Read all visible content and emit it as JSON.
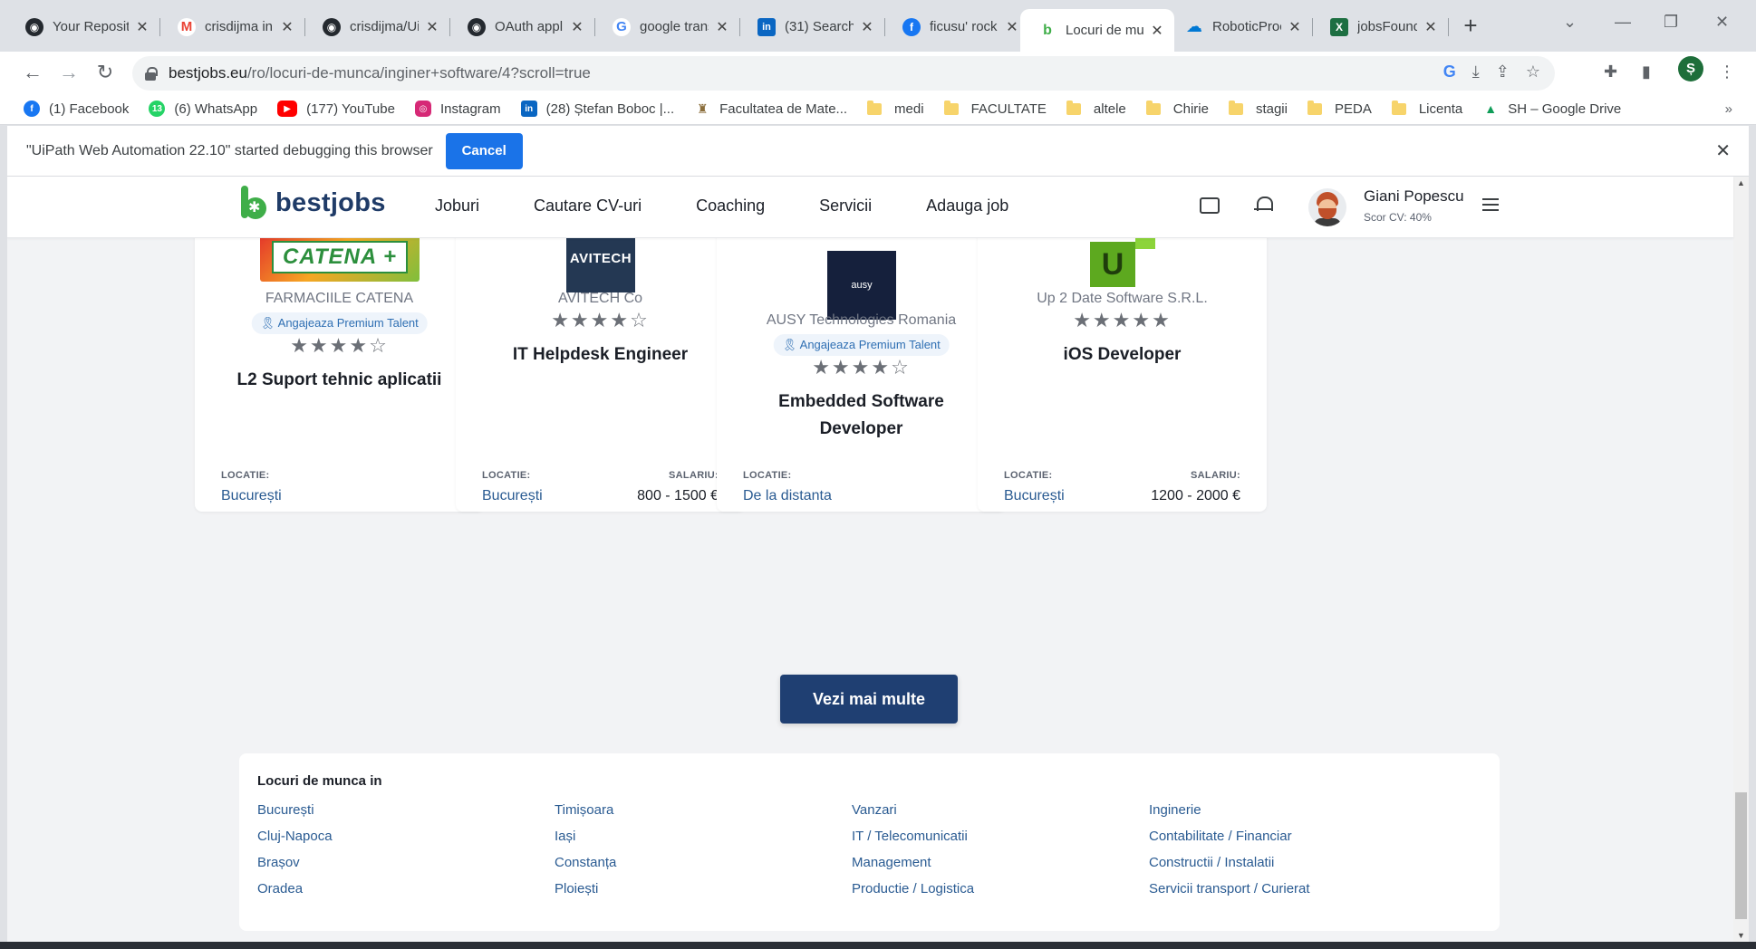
{
  "tabs": [
    {
      "title": "Your Repositories",
      "icon": "github-icon",
      "color": "#24292f",
      "glyph": "◉"
    },
    {
      "title": "crisdijma in",
      "icon": "gmail-icon",
      "color": "#ea4335",
      "glyph": "M"
    },
    {
      "title": "crisdijma/UiPath",
      "icon": "github-icon",
      "color": "#24292f",
      "glyph": "◉"
    },
    {
      "title": "OAuth application",
      "icon": "github-icon",
      "color": "#24292f",
      "glyph": "◉"
    },
    {
      "title": "google translate",
      "icon": "google-icon",
      "color": "#4285f4",
      "glyph": "G"
    },
    {
      "title": "(31) Search",
      "icon": "linkedin-icon",
      "color": "#0a66c2",
      "glyph": "in"
    },
    {
      "title": "ficusu' rock",
      "icon": "facebook-icon",
      "color": "#1877f2",
      "glyph": "f"
    },
    {
      "title": "Locuri de munca",
      "icon": "bestjobs-icon",
      "color": "#3fae49",
      "glyph": "b"
    },
    {
      "title": "RoboticProcess",
      "icon": "onedrive-icon",
      "color": "#0078d4",
      "glyph": "☁"
    },
    {
      "title": "jobsFound.xlsx",
      "icon": "excel-icon",
      "color": "#1d6f42",
      "glyph": "X"
    }
  ],
  "address": {
    "host": "bestjobs.eu",
    "path": "/ro/locuri-de-munca/inginer+software/4?scroll=true"
  },
  "profile_initial": "Ș",
  "bookmarks": [
    {
      "label": "(1) Facebook",
      "icon": "facebook-icon",
      "color": "#1877f2",
      "glyph": "f"
    },
    {
      "label": "(6) WhatsApp",
      "icon": "whatsapp-icon",
      "color": "#25d366",
      "glyph": "13"
    },
    {
      "label": "(177) YouTube",
      "icon": "youtube-icon",
      "color": "#ff0000",
      "glyph": "▶"
    },
    {
      "label": "Instagram",
      "icon": "instagram-icon",
      "color": "#d62976",
      "glyph": "◎"
    },
    {
      "label": "(28) Ștefan Boboc |...",
      "icon": "linkedin-icon",
      "color": "#0a66c2",
      "glyph": "in"
    },
    {
      "label": "Facultatea de Mate...",
      "icon": "university-icon",
      "color": "#8a6d3b",
      "glyph": "♜"
    },
    {
      "label": "medi",
      "icon": "folder-icon"
    },
    {
      "label": "FACULTATE",
      "icon": "folder-icon"
    },
    {
      "label": "altele",
      "icon": "folder-icon"
    },
    {
      "label": "Chirie",
      "icon": "folder-icon"
    },
    {
      "label": "stagii",
      "icon": "folder-icon"
    },
    {
      "label": "PEDA",
      "icon": "folder-icon"
    },
    {
      "label": "Licenta",
      "icon": "folder-icon"
    },
    {
      "label": "SH – Google Drive",
      "icon": "google-drive-icon",
      "color": "#0f9d58",
      "glyph": "▲"
    }
  ],
  "infobar": {
    "message": "\"UiPath Web Automation 22.10\" started debugging this browser",
    "cancel": "Cancel"
  },
  "site": {
    "logo": "bestjobs",
    "menu": [
      "Joburi",
      "Cautare CV-uri",
      "Coaching",
      "Servicii",
      "Adauga job"
    ],
    "user_name": "Giani Popescu",
    "user_score": "Scor CV: 40%"
  },
  "labels": {
    "location": "LOCATIE:",
    "salary": "SALARIU:"
  },
  "jobs": [
    {
      "company": "FARMACIILE CATENA",
      "premium": "Angajeaza Premium Talent",
      "stars": "★★★★☆",
      "rating": 4,
      "title": "L2 Suport tehnic aplicatii",
      "location": "București",
      "salary": ""
    },
    {
      "company": "AVITECH Co",
      "premium": "",
      "stars": "★★★★☆",
      "rating": 4,
      "title": "IT Helpdesk Engineer",
      "location": "București",
      "salary": "800 - 1500 €",
      "logo_text": "AVITECH"
    },
    {
      "company": "AUSY Technologies Romania",
      "premium": "Angajeaza Premium Talent",
      "stars": "★★★★☆",
      "rating": 4,
      "title": "Embedded Software Developer",
      "location": "De la distanta",
      "salary": "",
      "logo_text": "ausy"
    },
    {
      "company": "Up 2 Date Software S.R.L.",
      "premium": "",
      "stars": "★★★★★",
      "rating": 5,
      "title": "iOS Developer",
      "location": "București",
      "salary": "1200 - 2000 €"
    }
  ],
  "catena_logo_text": "CATENA +",
  "more_button": "Vezi mai multe",
  "cities": {
    "heading": "Locuri de munca in",
    "col1": [
      "București",
      "Cluj-Napoca",
      "Brașov",
      "Oradea"
    ],
    "col2": [
      "Timișoara",
      "Iași",
      "Constanța",
      "Ploiești"
    ],
    "col3": [
      "Vanzari",
      "IT / Telecomunicatii",
      "Management",
      "Productie / Logistica"
    ],
    "col4": [
      "Inginerie",
      "Contabilitate / Financiar",
      "Constructii / Instalatii",
      "Servicii transport / Curierat"
    ]
  }
}
